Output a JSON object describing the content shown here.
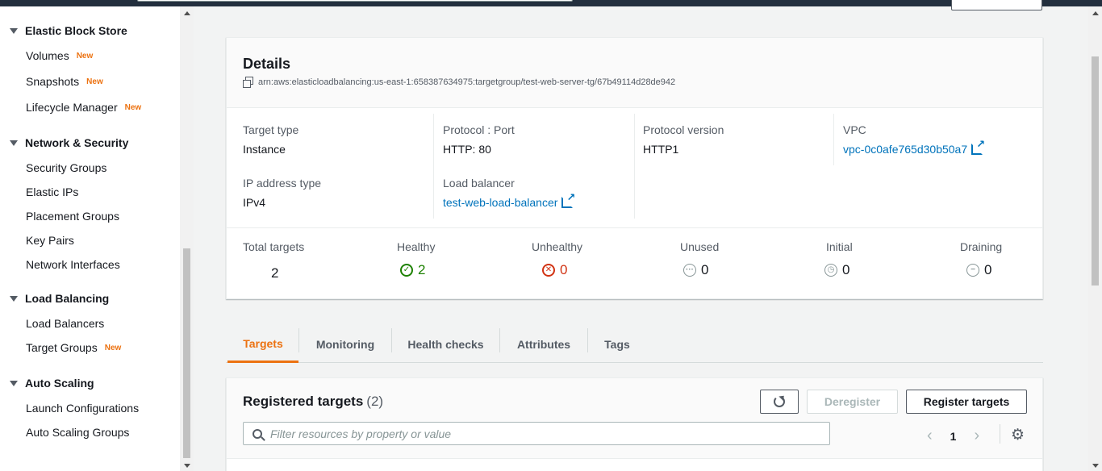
{
  "sidebar": {
    "sections": [
      {
        "label": "Elastic Block Store",
        "items": [
          {
            "label": "Volumes",
            "badge": "New"
          },
          {
            "label": "Snapshots",
            "badge": "New"
          },
          {
            "label": "Lifecycle Manager",
            "badge": "New"
          }
        ]
      },
      {
        "label": "Network & Security",
        "items": [
          {
            "label": "Security Groups"
          },
          {
            "label": "Elastic IPs"
          },
          {
            "label": "Placement Groups"
          },
          {
            "label": "Key Pairs"
          },
          {
            "label": "Network Interfaces"
          }
        ]
      },
      {
        "label": "Load Balancing",
        "items": [
          {
            "label": "Load Balancers"
          },
          {
            "label": "Target Groups",
            "badge": "New"
          }
        ]
      },
      {
        "label": "Auto Scaling",
        "items": [
          {
            "label": "Launch Configurations"
          },
          {
            "label": "Auto Scaling Groups"
          }
        ]
      }
    ]
  },
  "details": {
    "title": "Details",
    "arn": "arn:aws:elasticloadbalancing:us-east-1:658387634975:targetgroup/test-web-server-tg/67b49114d28de942",
    "target_type_label": "Target type",
    "target_type_value": "Instance",
    "protocol_port_label": "Protocol : Port",
    "protocol_port_value": "HTTP: 80",
    "protocol_version_label": "Protocol version",
    "protocol_version_value": "HTTP1",
    "vpc_label": "VPC",
    "vpc_value": "vpc-0c0afe765d30b50a7",
    "ip_type_label": "IP address type",
    "ip_type_value": "IPv4",
    "lb_label": "Load balancer",
    "lb_value": "test-web-load-balancer"
  },
  "stats": {
    "total_label": "Total targets",
    "total_value": "2",
    "healthy_label": "Healthy",
    "healthy_value": "2",
    "unhealthy_label": "Unhealthy",
    "unhealthy_value": "0",
    "unused_label": "Unused",
    "unused_value": "0",
    "initial_label": "Initial",
    "initial_value": "0",
    "draining_label": "Draining",
    "draining_value": "0",
    "colors": {
      "healthy": "#1d8102",
      "unhealthy": "#d13212",
      "neutral": "#687078"
    }
  },
  "tabs": [
    {
      "label": "Targets",
      "active": true
    },
    {
      "label": "Monitoring"
    },
    {
      "label": "Health checks"
    },
    {
      "label": "Attributes"
    },
    {
      "label": "Tags"
    }
  ],
  "registered": {
    "title": "Registered targets",
    "count": "(2)",
    "deregister_label": "Deregister",
    "register_label": "Register targets",
    "filter_placeholder": "Filter resources by property or value",
    "page": "1"
  },
  "icons": {
    "copy": "copy-icon",
    "external": "external-link-icon",
    "refresh": "refresh-icon",
    "search": "search-icon",
    "settings": "gear-icon"
  }
}
